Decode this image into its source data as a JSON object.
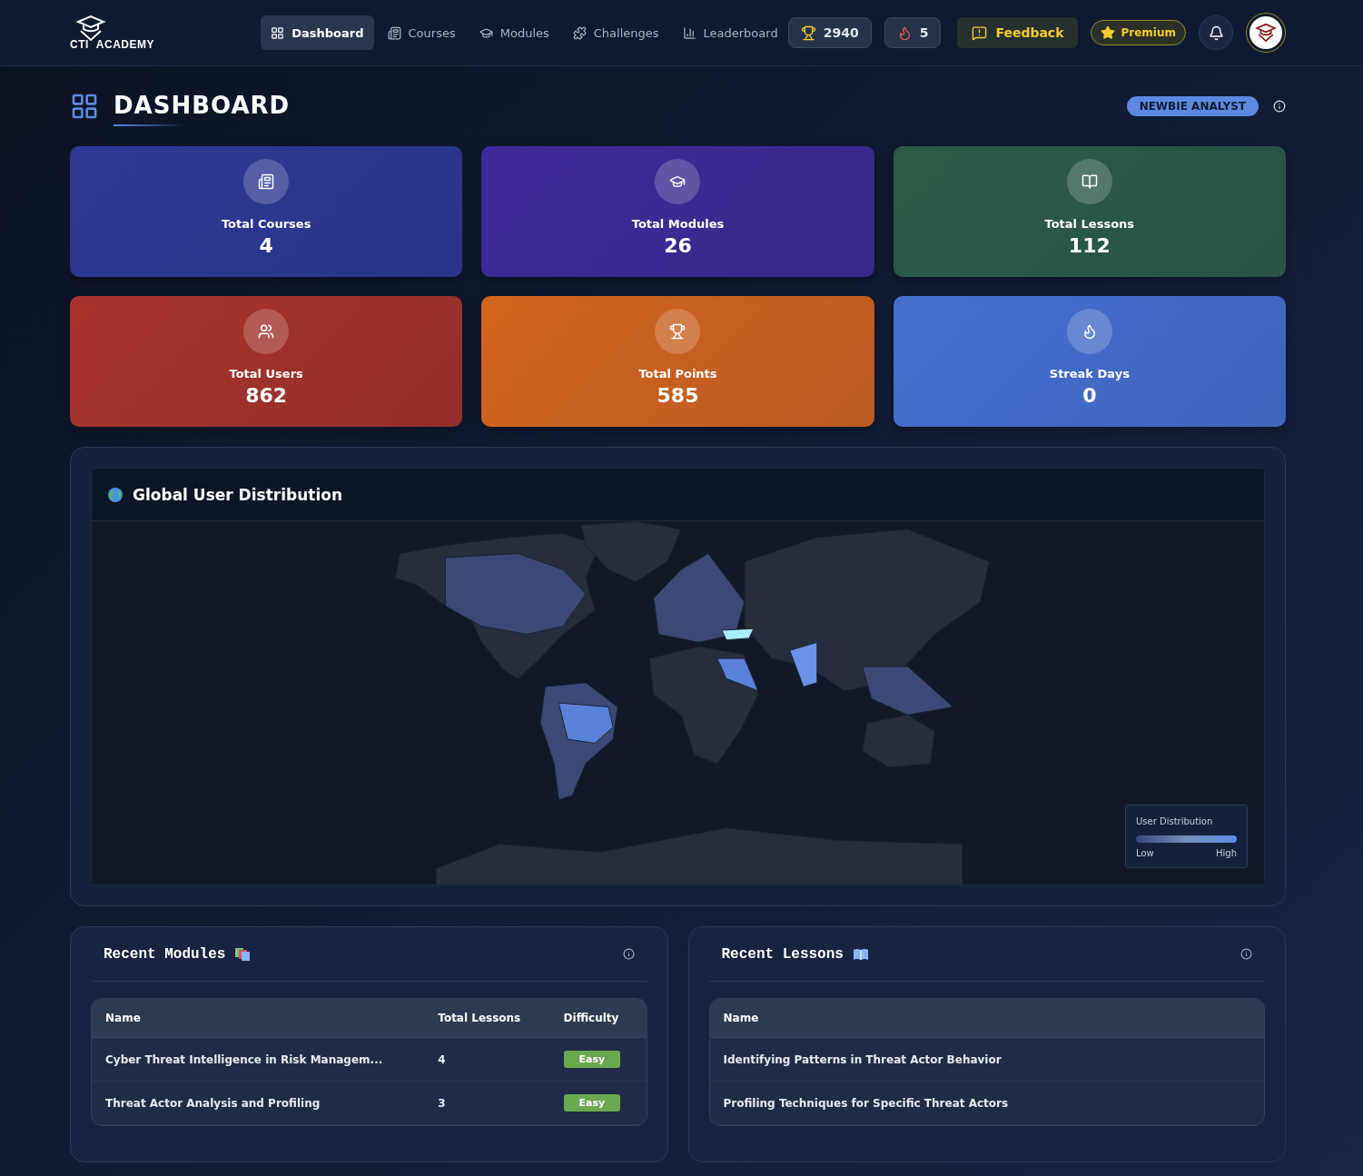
{
  "logo": {
    "left": "CTI",
    "right": "ACADEMY"
  },
  "nav": [
    {
      "label": "Dashboard",
      "selected": true
    },
    {
      "label": "Courses",
      "selected": false
    },
    {
      "label": "Modules",
      "selected": false
    },
    {
      "label": "Challenges",
      "selected": false
    },
    {
      "label": "Leaderboard",
      "selected": false
    }
  ],
  "header_stats": [
    {
      "kind": "trophy",
      "value": "2940"
    },
    {
      "kind": "flame",
      "value": "5"
    }
  ],
  "feedback_button": "Feedback",
  "premium_badge": "Premium",
  "page_title": "DASHBOARD",
  "rank_badge": "NEWBIE ANALYST",
  "stat_cards": [
    {
      "label": "Total Courses",
      "value": "4",
      "color": "#2c3a96"
    },
    {
      "label": "Total Modules",
      "value": "26",
      "color": "#3f2a98"
    },
    {
      "label": "Total Lessons",
      "value": "112",
      "color": "#2c5b48"
    },
    {
      "label": "Total Users",
      "value": "862",
      "color": "#a8332b"
    },
    {
      "label": "Total Points",
      "value": "585",
      "color": "#d3651f"
    },
    {
      "label": "Streak Days",
      "value": "0",
      "color": "#4470d0"
    }
  ],
  "map_panel": {
    "title": "Global User Distribution",
    "legend": {
      "title": "User Distribution",
      "low": "Low",
      "high": "High"
    }
  },
  "recent_modules": {
    "title": "Recent Modules",
    "columns": [
      "Name",
      "Total Lessons",
      "Difficulty"
    ],
    "rows": [
      {
        "name": "Cyber Threat Intelligence in Risk Managem...",
        "lessons": "4",
        "difficulty": "Easy"
      },
      {
        "name": "Threat Actor Analysis and Profiling",
        "lessons": "3",
        "difficulty": "Easy"
      }
    ]
  },
  "recent_lessons": {
    "title": "Recent Lessons",
    "columns": [
      "Name"
    ],
    "rows": [
      {
        "name": "Identifying Patterns in Threat Actor Behavior"
      },
      {
        "name": "Profiling Techniques for Specific Threat Actors"
      }
    ]
  }
}
